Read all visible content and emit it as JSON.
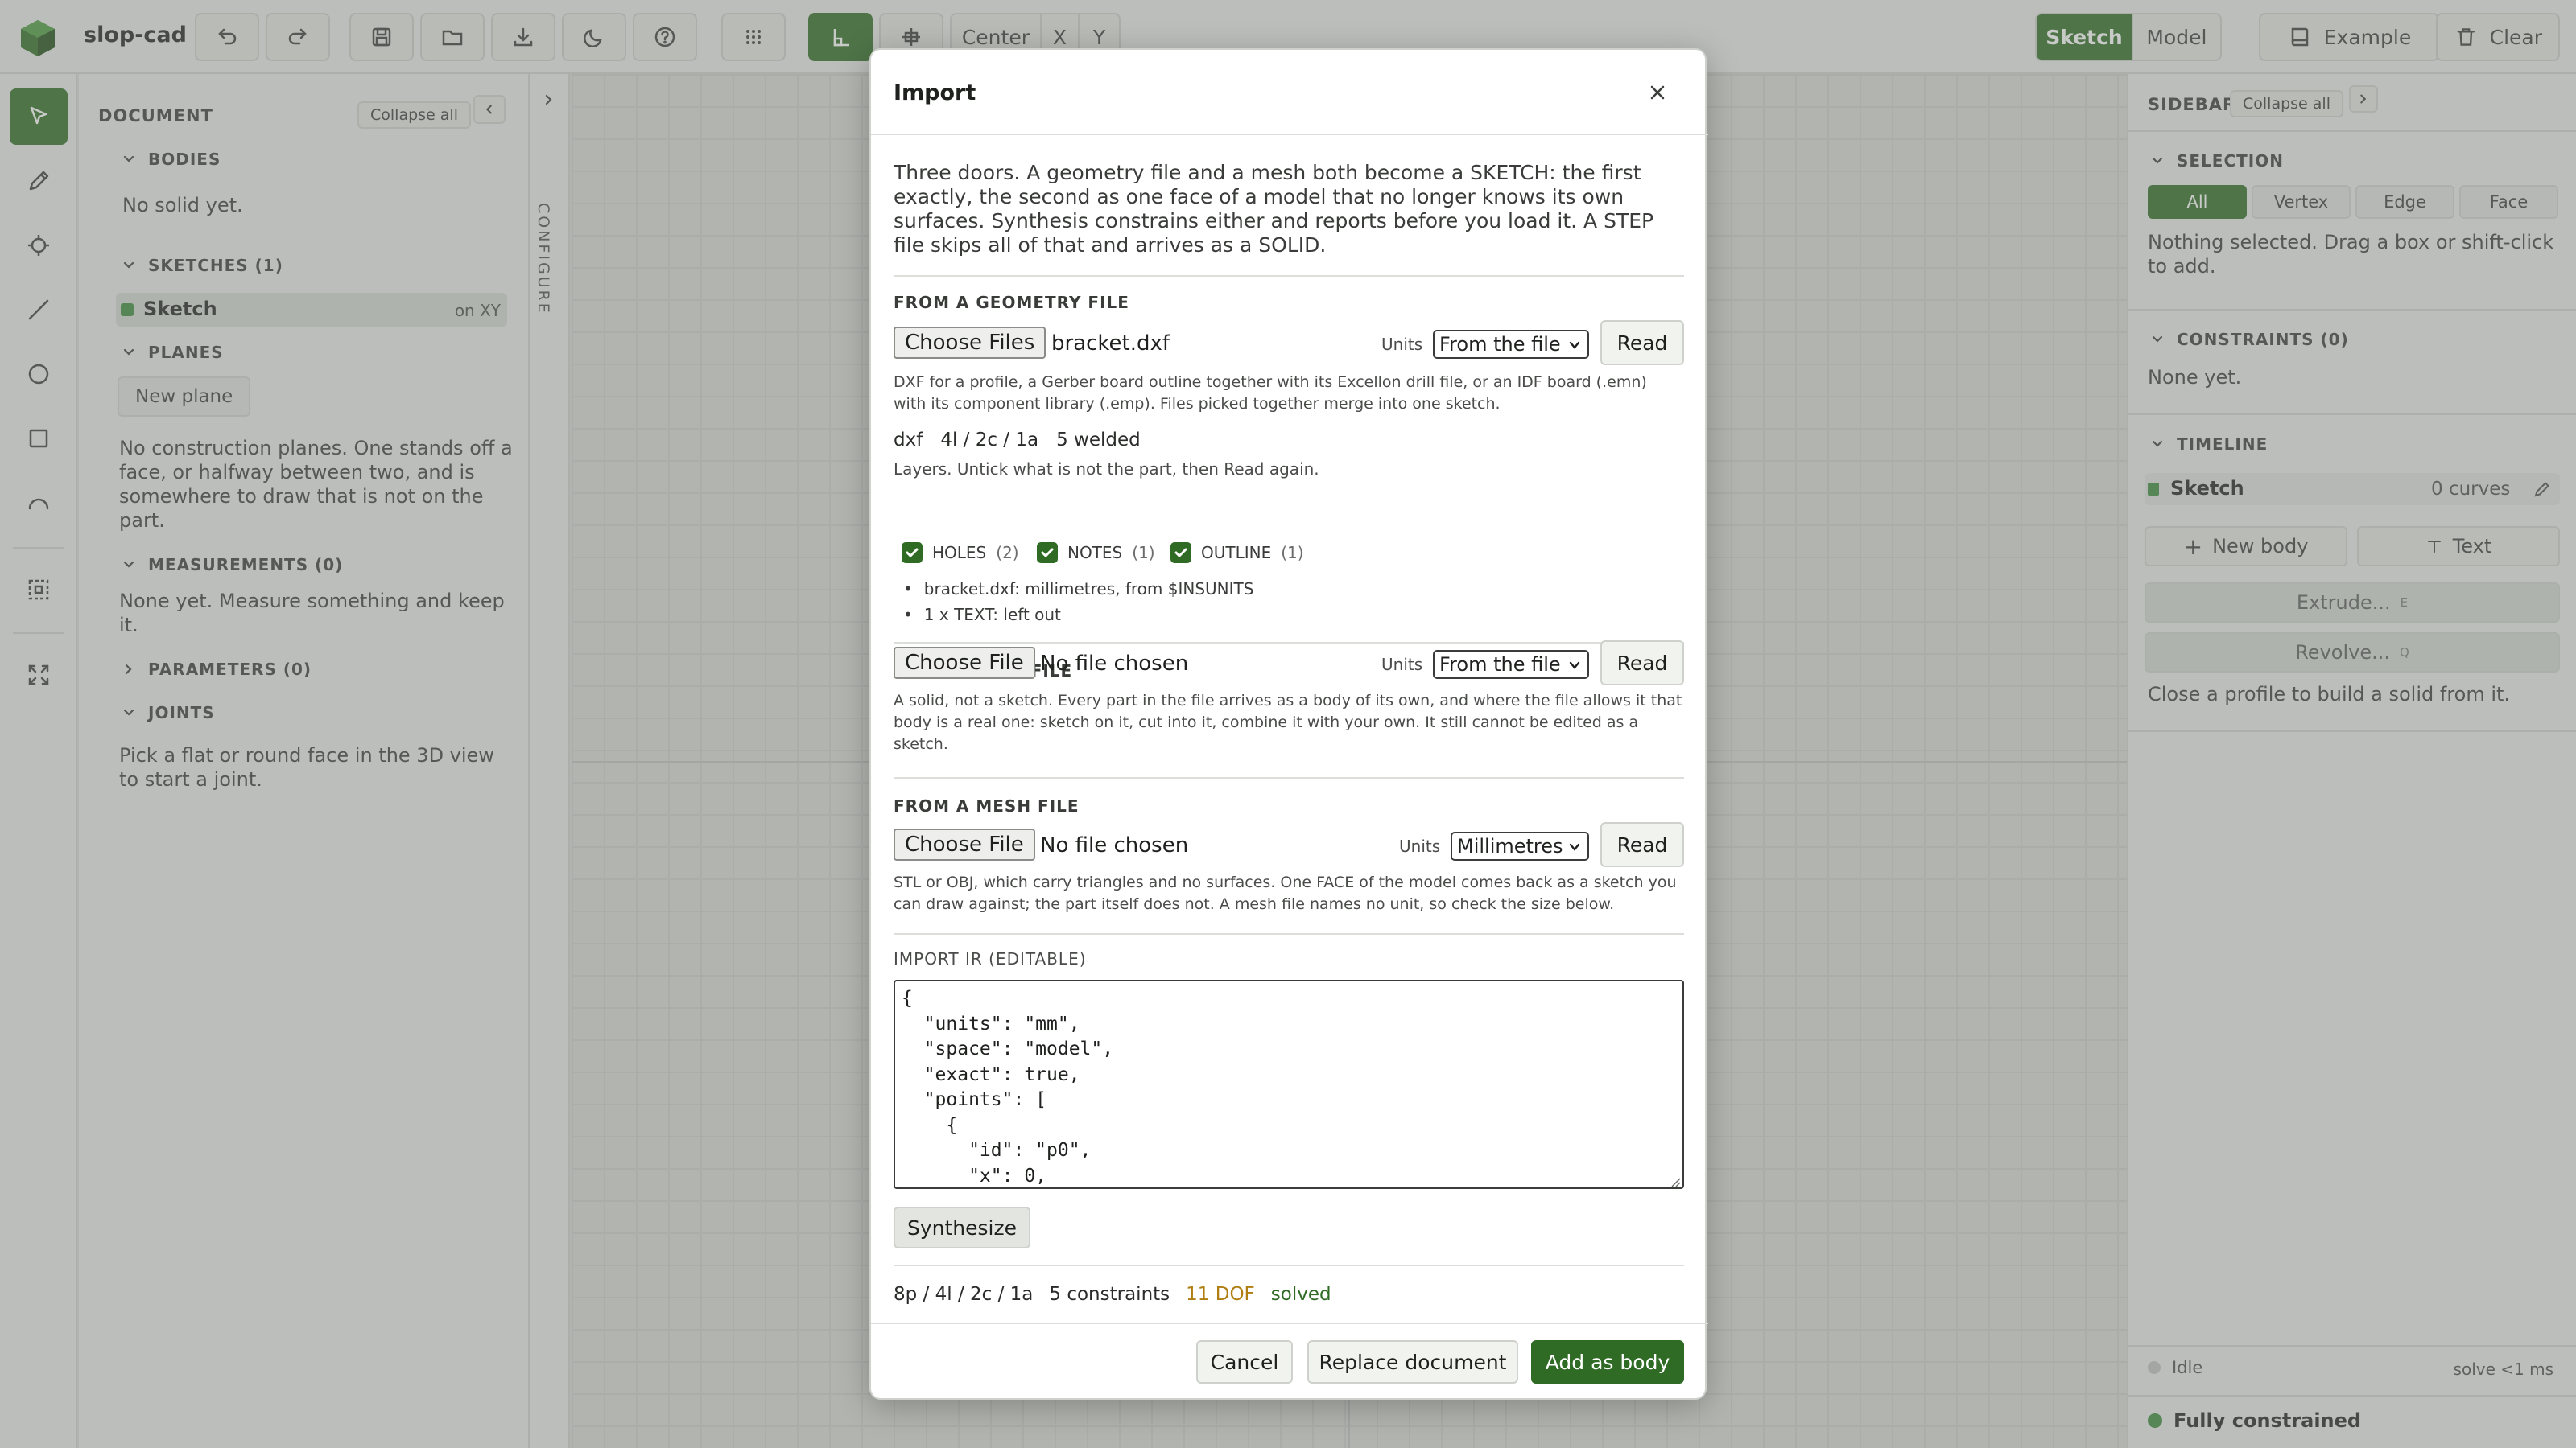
{
  "app": {
    "title": "slop-cad"
  },
  "toolbar": {
    "snap_segment": [
      "Center",
      "X",
      "Y"
    ],
    "mode_segment": [
      "Sketch",
      "Model"
    ],
    "example_label": "Example",
    "clear_label": "Clear"
  },
  "document": {
    "heading": "DOCUMENT",
    "collapse_label": "Collapse all",
    "bodies": {
      "title": "BODIES",
      "empty": "No solid yet."
    },
    "sketches": {
      "title": "SKETCHES (1)",
      "item_name": "Sketch",
      "item_plane": "on XY"
    },
    "planes": {
      "title": "PLANES",
      "new_plane": "New plane",
      "text": "No construction planes. One stands off a face, or halfway between two, and is somewhere to draw that is not on the part."
    },
    "measurements": {
      "title": "MEASUREMENTS (0)",
      "text": "None yet. Measure something and keep it."
    },
    "parameters": {
      "title": "PARAMETERS (0)"
    },
    "joints": {
      "title": "JOINTS",
      "text": "Pick a flat or round face in the 3D view to start a joint."
    },
    "configure": "CONFIGURE"
  },
  "sidebar": {
    "heading": "SIDEBAR",
    "collapse_label": "Collapse all",
    "selection": {
      "title": "SELECTION",
      "filters": [
        "All",
        "Vertex",
        "Edge",
        "Face"
      ],
      "text": "Nothing selected. Drag a box or shift-click to add."
    },
    "constraints": {
      "title": "CONSTRAINTS (0)",
      "text": "None yet."
    },
    "timeline": {
      "title": "TIMELINE",
      "item_name": "Sketch",
      "item_count": "0 curves",
      "new_body": "New body",
      "text_btn": "Text",
      "extrude": "Extrude...",
      "extrude_key": "E",
      "revolve": "Revolve...",
      "revolve_key": "Q",
      "hint": "Close a profile to build a solid from it."
    },
    "status": {
      "state": "Idle",
      "solve": "solve <1 ms",
      "constraint_state": "Fully constrained"
    }
  },
  "modal": {
    "title": "Import",
    "intro": "Three doors. A geometry file and a mesh both become a SKETCH: the first exactly, the second as one face of a model that no longer knows its own surfaces. Synthesis constrains either and reports before you load it. A STEP file skips all of that and arrives as a SOLID.",
    "geometry": {
      "title": "FROM A GEOMETRY FILE",
      "choose": "Choose Files",
      "file": "bracket.dxf",
      "units_label": "Units",
      "units": "From the file",
      "read": "Read",
      "help": "DXF for a profile, a Gerber board outline together with its Excellon drill file, or an IDF board (.emn) with its component library (.emp). Files picked together merge into one sketch.",
      "stats": [
        "dxf",
        "4l / 2c / 1a",
        "5 welded"
      ],
      "layers_hint": "Layers. Untick what is not the part, then Read again.",
      "layers": [
        {
          "name": "HOLES",
          "count": "(2)"
        },
        {
          "name": "NOTES",
          "count": "(1)"
        },
        {
          "name": "OUTLINE",
          "count": "(1)"
        }
      ],
      "notes": [
        "bracket.dxf: millimetres, from $INSUNITS",
        "1 x TEXT: left out"
      ]
    },
    "step": {
      "title": "FROM A STEP FILE",
      "choose": "Choose File",
      "file": "No file chosen",
      "units_label": "Units",
      "units": "From the file",
      "read": "Read",
      "help": "A solid, not a sketch. Every part in the file arrives as a body of its own, and where the file allows it that body is a real one: sketch on it, cut into it, combine it with your own. It still cannot be edited as a sketch."
    },
    "mesh": {
      "title": "FROM A MESH FILE",
      "choose": "Choose File",
      "file": "No file chosen",
      "units_label": "Units",
      "units": "Millimetres",
      "read": "Read",
      "help": "STL or OBJ, which carry triangles and no surfaces. One FACE of the model comes back as a sketch you can draw against; the part itself does not. A mesh file names no unit, so check the size below."
    },
    "ir": {
      "label": "IMPORT IR (EDITABLE)",
      "content": "{\n  \"units\": \"mm\",\n  \"space\": \"model\",\n  \"exact\": true,\n  \"points\": [\n    {\n      \"id\": \"p0\",\n      \"x\": 0,"
    },
    "synthesize": "Synthesize",
    "summary": {
      "counts": "8p / 4l / 2c / 1a",
      "constraints": "5 constraints",
      "dof": "11 DOF",
      "status": "solved"
    },
    "cancel": "Cancel",
    "replace": "Replace document",
    "add": "Add as body"
  },
  "colors": {
    "accent": "#2f6b24",
    "warning": "#b07d10",
    "idle_dot": "#bfc2bd",
    "ok_dot": "#3c8a3a"
  }
}
